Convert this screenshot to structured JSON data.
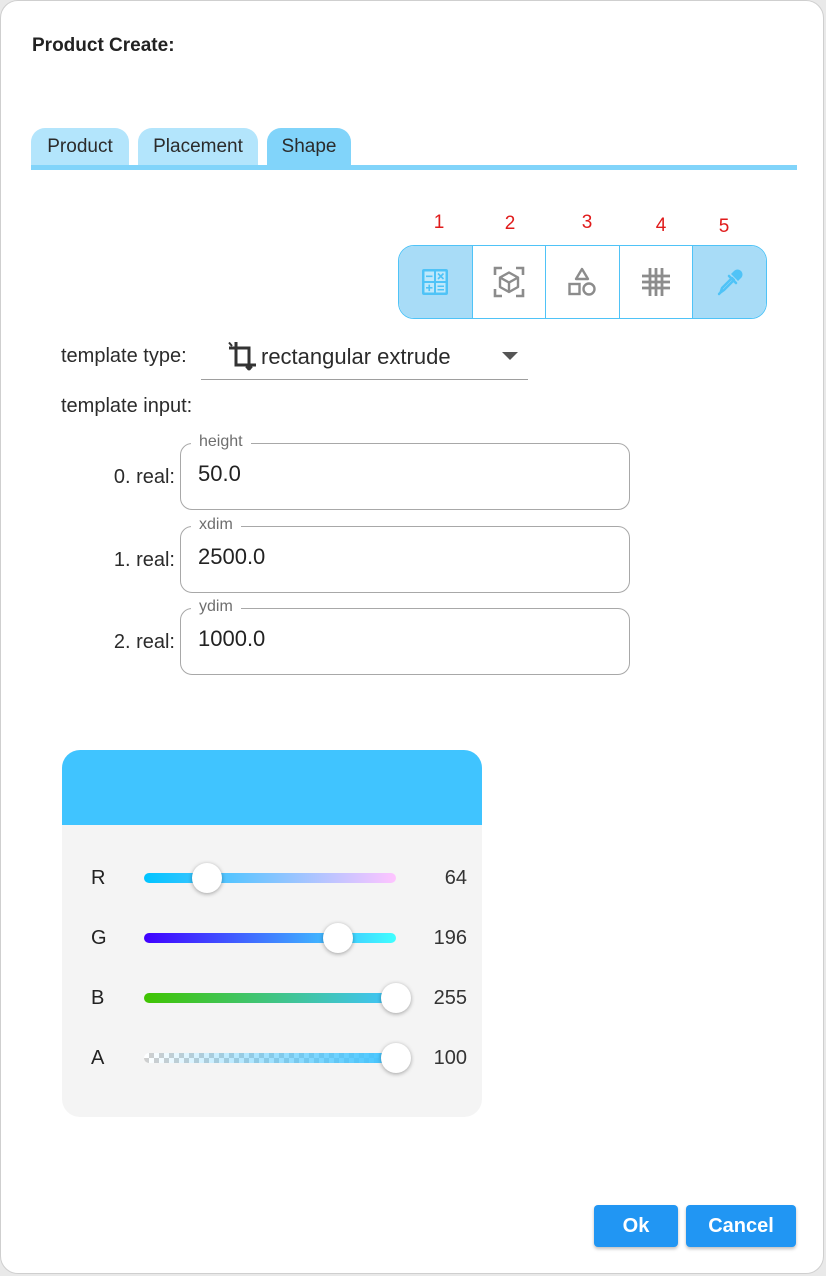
{
  "dialog": {
    "title": "Product Create:"
  },
  "tabs": [
    {
      "label": "Product"
    },
    {
      "label": "Placement"
    },
    {
      "label": "Shape",
      "active": true
    }
  ],
  "toolbar": {
    "numbers": [
      "1",
      "2",
      "3",
      "4",
      "5"
    ],
    "tools": [
      {
        "icon": "calculator-icon",
        "selected": true
      },
      {
        "icon": "cube-scan-icon",
        "selected": false
      },
      {
        "icon": "shapes-icon",
        "selected": false
      },
      {
        "icon": "grid-icon",
        "selected": false
      },
      {
        "icon": "eyedropper-icon",
        "selected": true
      }
    ]
  },
  "template": {
    "type_label": "template type:",
    "type_value": "rectangular extrude",
    "type_icon": "crop-icon",
    "input_label": "template input:",
    "fields": [
      {
        "row_label": "0. real:",
        "legend": "height",
        "value": "50.0"
      },
      {
        "row_label": "1. real:",
        "legend": "xdim",
        "value": "2500.0"
      },
      {
        "row_label": "2. real:",
        "legend": "ydim",
        "value": "1000.0"
      }
    ]
  },
  "color_picker": {
    "preview_color": "#40c4ff",
    "channels": [
      {
        "label": "R",
        "value": "64",
        "fraction": 0.251
      },
      {
        "label": "G",
        "value": "196",
        "fraction": 0.769
      },
      {
        "label": "B",
        "value": "255",
        "fraction": 1.0
      },
      {
        "label": "A",
        "value": "100",
        "fraction": 1.0
      }
    ]
  },
  "buttons": {
    "ok": "Ok",
    "cancel": "Cancel"
  },
  "colors": {
    "accent": "#2196f3",
    "tab": "#b3e5fc",
    "tab_active": "#81d4fa",
    "annotation": "#e01b1b"
  }
}
